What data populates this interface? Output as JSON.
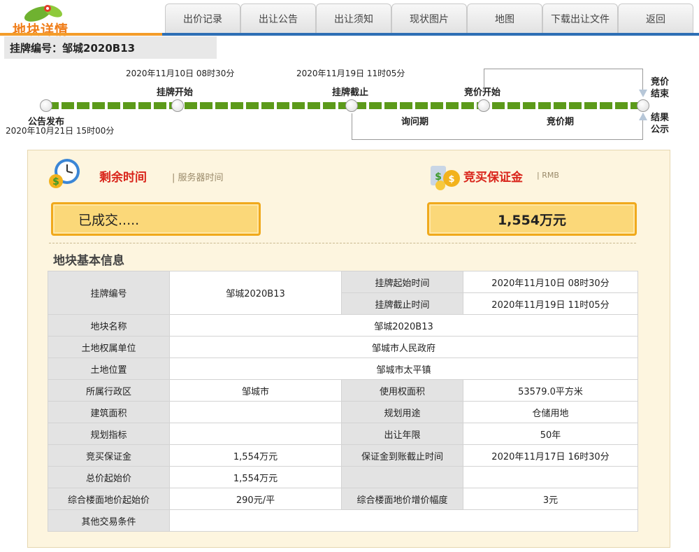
{
  "header": {
    "logo_text": "地块详情",
    "tabs": [
      "出价记录",
      "出让公告",
      "出让须知",
      "现状图片",
      "地图",
      "下载出让文件",
      "返回"
    ]
  },
  "plot_bar": {
    "label": "挂牌编号：",
    "value": "邹城2020B13"
  },
  "timeline": {
    "announce_label": "公告发布",
    "announce_time": "2020年10月21日 15时00分",
    "listing_start_label": "挂牌开始",
    "listing_start_time": "2020年11月10日 08时30分",
    "listing_end_label": "挂牌截止",
    "listing_end_time": "2020年11月19日 11时05分",
    "bidding_start_label": "竞价开始",
    "inquiry_period": "询问期",
    "bidding_period": "竞价期",
    "bidding_end_label": [
      "竞价",
      "结束"
    ],
    "result_label": [
      "结果",
      "公示"
    ]
  },
  "status": {
    "remaining_title": "剩余时间",
    "remaining_sub": "| 服务器时间",
    "remaining_value": "已成交.....",
    "deposit_title": "竞买保证金",
    "deposit_sub": "| RMB",
    "deposit_value": "1,554万元"
  },
  "info": {
    "title": "地块基本信息",
    "plot_no_label": "挂牌编号",
    "plot_no": "邹城2020B13",
    "listing_start_label": "挂牌起始时间",
    "listing_start": "2020年11月10日 08时30分",
    "listing_end_label": "挂牌截止时间",
    "listing_end": "2020年11月19日 11时05分",
    "name_label": "地块名称",
    "name": "邹城2020B13",
    "owner_label": "土地权属单位",
    "owner": "邹城市人民政府",
    "location_label": "土地位置",
    "location": "邹城市太平镇",
    "district_label": "所属行政区",
    "district": "邹城市",
    "use_area_label": "使用权面积",
    "use_area": "53579.0平方米",
    "building_area_label": "建筑面积",
    "building_area": "",
    "planned_use_label": "规划用途",
    "planned_use": "仓储用地",
    "plan_index_label": "规划指标",
    "plan_index": "",
    "term_label": "出让年限",
    "term": "50年",
    "deposit_label": "竞买保证金",
    "deposit": "1,554万元",
    "deposit_deadline_label": "保证金到账截止时间",
    "deposit_deadline": "2020年11月17日 16时30分",
    "start_price_label": "总价起始价",
    "start_price": "1,554万元",
    "floor_price_label": "综合楼面地价起始价",
    "floor_price": "290元/平",
    "increment_label": "综合楼面地价增价幅度",
    "increment": "3元",
    "other_label": "其他交易条件",
    "other": ""
  },
  "colors": {
    "accent_orange": "#f39c2a",
    "accent_blue": "#2e6fb5",
    "timeline_green": "#5c9a1a",
    "title_red": "#d9261c",
    "status_box": "#fbd879"
  }
}
